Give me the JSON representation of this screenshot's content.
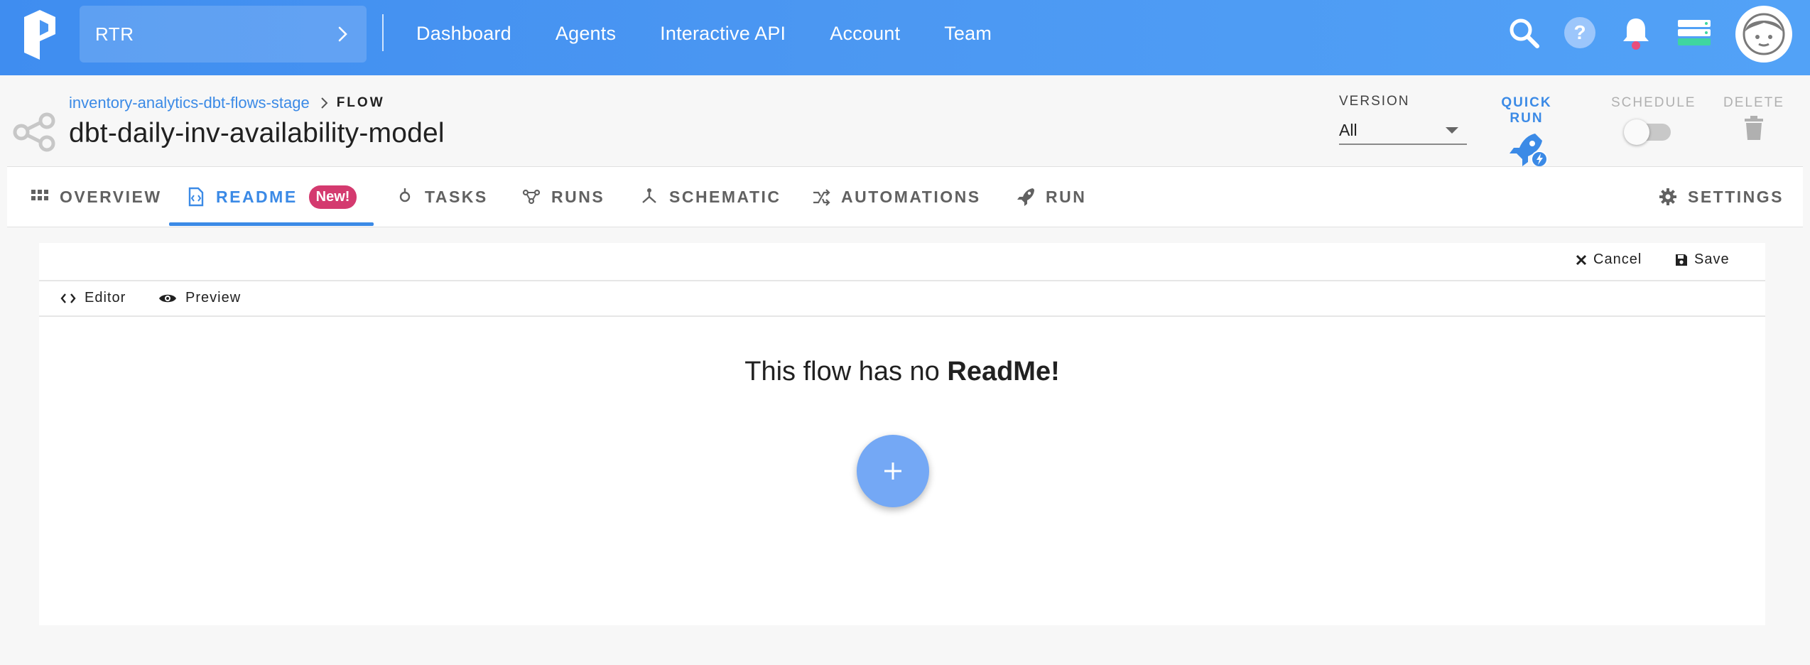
{
  "app": {
    "team_name": "RTR",
    "nav": [
      "Dashboard",
      "Agents",
      "Interactive API",
      "Account",
      "Team"
    ],
    "icons": [
      "search-icon",
      "help-icon",
      "notifications-icon",
      "agents-status-icon",
      "avatar"
    ]
  },
  "flow": {
    "breadcrumb_project": "inventory-analytics-dbt-flows-stage",
    "breadcrumb_type": "FLOW",
    "title": "dbt-daily-inv-availability-model"
  },
  "controls": {
    "version_label": "VERSION",
    "version_value": "All",
    "quick_run_label": "QUICK RUN",
    "schedule_label": "SCHEDULE",
    "schedule_on": false,
    "delete_label": "DELETE"
  },
  "tabs": [
    {
      "label": "OVERVIEW",
      "icon": "grid-icon"
    },
    {
      "label": "README",
      "icon": "readme-file-icon",
      "badge": "New!",
      "active": true
    },
    {
      "label": "TASKS",
      "icon": "task-icon"
    },
    {
      "label": "RUNS",
      "icon": "runs-icon"
    },
    {
      "label": "SCHEMATIC",
      "icon": "schematic-icon"
    },
    {
      "label": "AUTOMATIONS",
      "icon": "automations-icon"
    },
    {
      "label": "RUN",
      "icon": "rocket-icon"
    },
    {
      "label": "SETTINGS",
      "icon": "gear-icon"
    }
  ],
  "readme": {
    "cancel_label": "Cancel",
    "save_label": "Save",
    "editor_label": "Editor",
    "preview_label": "Preview",
    "empty_prefix": "This flow has no ",
    "empty_bold": "ReadMe!"
  },
  "colors": {
    "brand_blue": "#3b8ae6",
    "badge_pink": "#d43a6f",
    "fab_blue": "#74a8f5"
  }
}
